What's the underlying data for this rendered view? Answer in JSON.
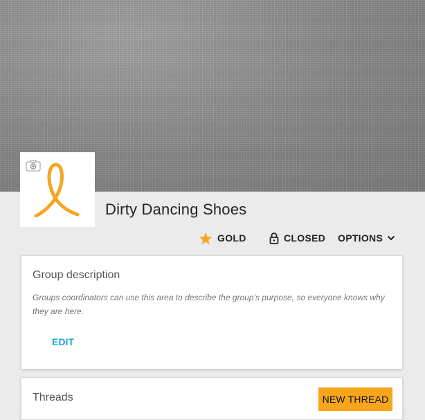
{
  "group": {
    "name": "Dirty Dancing Shoes"
  },
  "meta": {
    "level_label": "GOLD",
    "privacy_label": "CLOSED",
    "options_label": "OPTIONS"
  },
  "description_card": {
    "heading": "Group description",
    "body": "Groups coordinators can use this area to describe the group’s purpose, so everyone knows why they are here.",
    "edit_label": "EDIT"
  },
  "threads_card": {
    "heading": "Threads",
    "new_thread_label": "NEW THREAD"
  },
  "colors": {
    "accent_orange": "#f8a51c",
    "link_blue": "#1ba9d6",
    "star": "#f5a623"
  },
  "icons": {
    "camera": "camera-icon",
    "logo": "ribbon-logo",
    "star": "star-icon",
    "lock": "lock-icon",
    "chevron": "chevron-down-icon"
  }
}
